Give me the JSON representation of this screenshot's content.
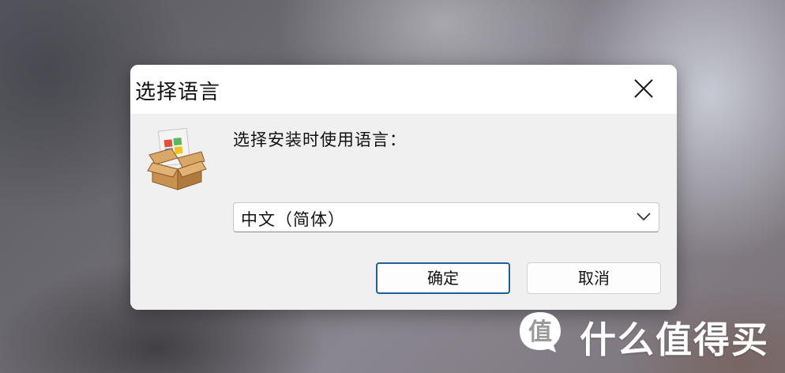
{
  "dialog": {
    "title": "选择语言",
    "close_icon": "close-icon",
    "app_icon": "installer-package-icon",
    "prompt": "选择安装时使用语言：",
    "language_select": {
      "selected": "中文（简体）",
      "icon": "chevron-down-icon"
    },
    "ok_label": "确定",
    "cancel_label": "取消"
  },
  "watermark": {
    "text": "什么值得买",
    "logo": "smzdm-logo"
  },
  "colors": {
    "dialog_bg": "#f0f0f0",
    "titlebar_bg": "#ffffff",
    "default_button_border": "#1f5f9f",
    "package_box": "#c8914f"
  }
}
